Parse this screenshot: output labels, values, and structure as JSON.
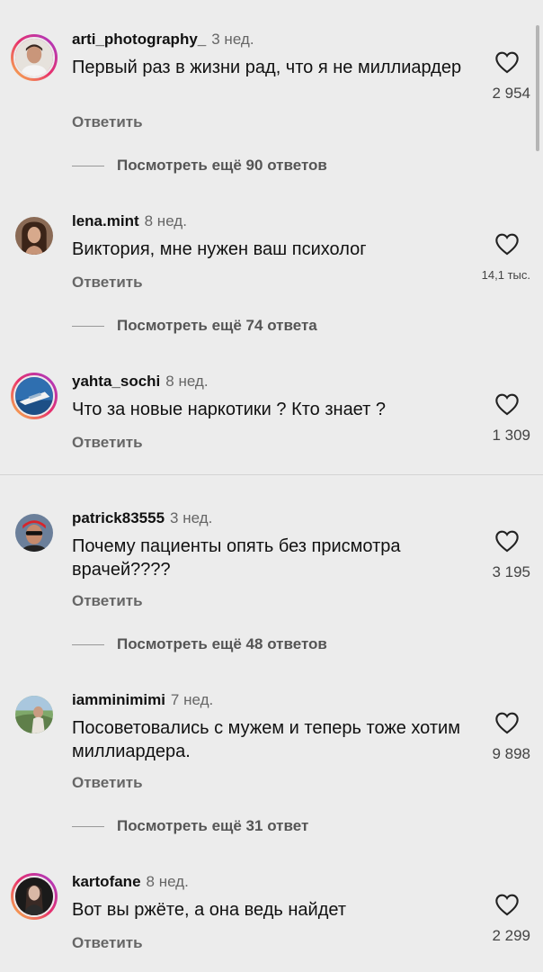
{
  "comments": [
    {
      "username": "arti_photography_",
      "time": "3 нед.",
      "text": "Первый раз в жизни рад, что я не миллиардер",
      "reply": "Ответить",
      "likes": "2 954",
      "more": "Посмотреть ещё 90 ответов",
      "avatar_ring": true
    },
    {
      "username": "lena.mint",
      "time": "8 нед.",
      "text": "Виктория, мне нужен ваш психолог",
      "reply": "Ответить",
      "likes": "14,1 тыс.",
      "more": "Посмотреть ещё 74 ответа",
      "avatar_ring": false
    },
    {
      "username": "yahta_sochi",
      "time": "8 нед.",
      "text": "Что за новые наркотики ? Кто знает ?",
      "reply": "Ответить",
      "likes": "1 309",
      "avatar_ring": true
    },
    {
      "username": "patrick83555",
      "time": "3 нед.",
      "text": "Почему пациенты опять без присмотра врачей????",
      "reply": "Ответить",
      "likes": "3 195",
      "more": "Посмотреть ещё 48 ответов",
      "avatar_ring": false
    },
    {
      "username": "iamminimimi",
      "time": "7 нед.",
      "text": "Посоветовались с мужем и теперь тоже хотим миллиардера.",
      "reply": "Ответить",
      "likes": "9 898",
      "more": "Посмотреть ещё 31 ответ",
      "avatar_ring": false
    },
    {
      "username": "kartofane",
      "time": "8 нед.",
      "text": "Вот вы ржёте, а она ведь найдет",
      "reply": "Ответить",
      "likes": "2 299",
      "avatar_ring": true
    }
  ],
  "icons": {
    "like": "heart-outline-icon"
  },
  "colors": {
    "background": "#ececec",
    "secondary_text": "#666666",
    "story_ring": "#e8306b"
  }
}
